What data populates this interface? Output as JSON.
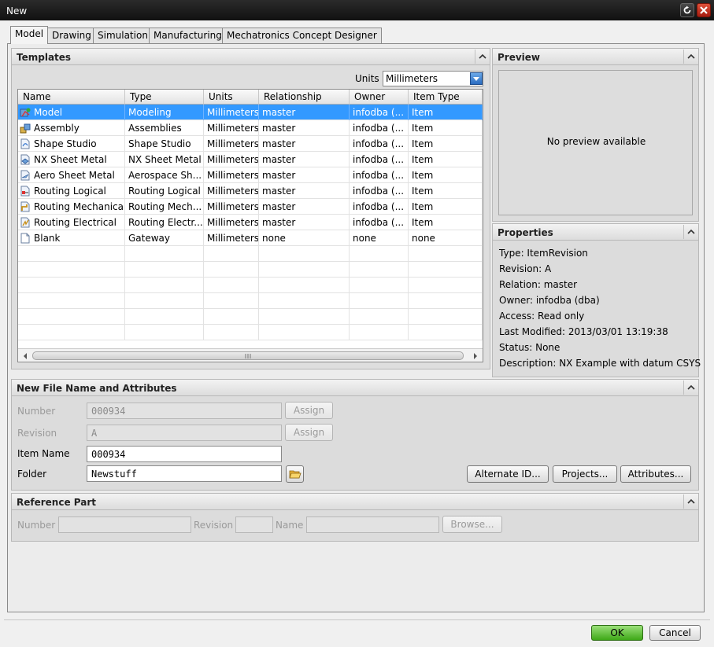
{
  "window": {
    "title": "New"
  },
  "tabs": [
    {
      "label": "Model"
    },
    {
      "label": "Drawing"
    },
    {
      "label": "Simulation"
    },
    {
      "label": "Manufacturing"
    },
    {
      "label": "Mechatronics Concept Designer"
    }
  ],
  "templates": {
    "header": "Templates",
    "units_label": "Units",
    "units_value": "Millimeters",
    "columns": [
      "Name",
      "Type",
      "Units",
      "Relationship",
      "Owner",
      "Item Type"
    ],
    "rows": [
      {
        "icon": "model-icon",
        "name": "Model",
        "type": "Modeling",
        "units": "Millimeters",
        "relationship": "master",
        "owner": "infodba (...",
        "item_type": "Item"
      },
      {
        "icon": "assembly-icon",
        "name": "Assembly",
        "type": "Assemblies",
        "units": "Millimeters",
        "relationship": "master",
        "owner": "infodba (...",
        "item_type": "Item"
      },
      {
        "icon": "shape-studio-icon",
        "name": "Shape Studio",
        "type": "Shape Studio",
        "units": "Millimeters",
        "relationship": "master",
        "owner": "infodba (...",
        "item_type": "Item"
      },
      {
        "icon": "sheet-metal-icon",
        "name": "NX Sheet Metal",
        "type": "NX Sheet Metal",
        "units": "Millimeters",
        "relationship": "master",
        "owner": "infodba (...",
        "item_type": "Item"
      },
      {
        "icon": "aero-sheet-metal-icon",
        "name": "Aero Sheet Metal",
        "type": "Aerospace Sh...",
        "units": "Millimeters",
        "relationship": "master",
        "owner": "infodba (...",
        "item_type": "Item"
      },
      {
        "icon": "routing-logical-icon",
        "name": "Routing Logical",
        "type": "Routing Logical",
        "units": "Millimeters",
        "relationship": "master",
        "owner": "infodba (...",
        "item_type": "Item"
      },
      {
        "icon": "routing-mechanical-icon",
        "name": "Routing Mechanical",
        "type": "Routing Mech...",
        "units": "Millimeters",
        "relationship": "master",
        "owner": "infodba (...",
        "item_type": "Item"
      },
      {
        "icon": "routing-electrical-icon",
        "name": "Routing Electrical",
        "type": "Routing Electr...",
        "units": "Millimeters",
        "relationship": "master",
        "owner": "infodba (...",
        "item_type": "Item"
      },
      {
        "icon": "blank-icon",
        "name": "Blank",
        "type": "Gateway",
        "units": "Millimeters",
        "relationship": "none",
        "owner": "none",
        "item_type": "none"
      }
    ],
    "selected_row": 0
  },
  "preview": {
    "header": "Preview",
    "empty_text": "No preview available"
  },
  "properties": {
    "header": "Properties",
    "lines": [
      "Type: ItemRevision",
      "Revision: A",
      "Relation: master",
      "Owner: infodba (dba)",
      "Access: Read only",
      "Last Modified: 2013/03/01 13:19:38",
      "Status: None",
      "Description: NX Example with datum CSYS"
    ]
  },
  "new_file": {
    "header": "New File Name and Attributes",
    "number_label": "Number",
    "number_value": "000934",
    "revision_label": "Revision",
    "revision_value": "A",
    "assign_label": "Assign",
    "item_name_label": "Item Name",
    "item_name_value": "000934",
    "folder_label": "Folder",
    "folder_value": "Newstuff",
    "alternate_id_label": "Alternate ID...",
    "projects_label": "Projects...",
    "attributes_label": "Attributes..."
  },
  "reference_part": {
    "header": "Reference Part",
    "number_label": "Number",
    "revision_label": "Revision",
    "name_label": "Name",
    "browse_label": "Browse..."
  },
  "footer": {
    "ok_label": "OK",
    "cancel_label": "Cancel"
  },
  "colors": {
    "selection": "#3399ff",
    "ok_green": "#4fb526",
    "close_red": "#c62a18"
  }
}
